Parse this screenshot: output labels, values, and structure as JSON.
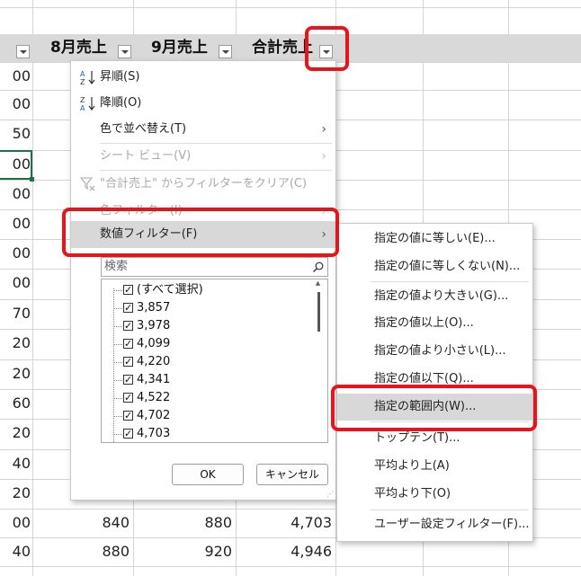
{
  "headers": {
    "col_prev_suffix": "上",
    "aug": "8月売上",
    "sep": "9月売上",
    "total": "合計売上"
  },
  "left_col_values": [
    "00",
    "00",
    "50",
    "00",
    "00",
    "00",
    "00",
    "00",
    "70",
    "20",
    "20",
    "60",
    "20",
    "40",
    "20",
    "00",
    "40"
  ],
  "bottom_rows": [
    {
      "aug": "840",
      "sep": "880",
      "total": "4,703"
    },
    {
      "aug": "880",
      "sep": "920",
      "total": "4,946"
    }
  ],
  "menu": {
    "sort_asc": "昇順(S)",
    "sort_desc": "降順(O)",
    "sort_by_color": "色で並べ替え(T)",
    "sheet_view": "シート ビュー(V)",
    "clear_filter": "\"合計売上\" からフィルターをクリア(C)",
    "color_filter": "色フィルター(I)",
    "number_filter": "数値フィルター(F)",
    "search_placeholder": "検索",
    "list_items": [
      "(すべて選択)",
      "3,857",
      "3,978",
      "4,099",
      "4,220",
      "4,341",
      "4,522",
      "4,702",
      "4,703"
    ],
    "ok": "OK",
    "cancel": "キャンセル"
  },
  "submenu": {
    "items": [
      "指定の値に等しい(E)...",
      "指定の値に等しくない(N)...",
      "指定の値より大きい(G)...",
      "指定の値以上(O)...",
      "指定の値より小さい(L)...",
      "指定の値以下(Q)...",
      "指定の範囲内(W)...",
      "トップテン(T)...",
      "平均より上(A)",
      "平均より下(O)",
      "ユーザー設定フィルター(F)..."
    ]
  },
  "colors": {
    "highlight_border": "#e8141a",
    "header_band": "#d9d9d9",
    "selected_cell": "#1e7145"
  }
}
